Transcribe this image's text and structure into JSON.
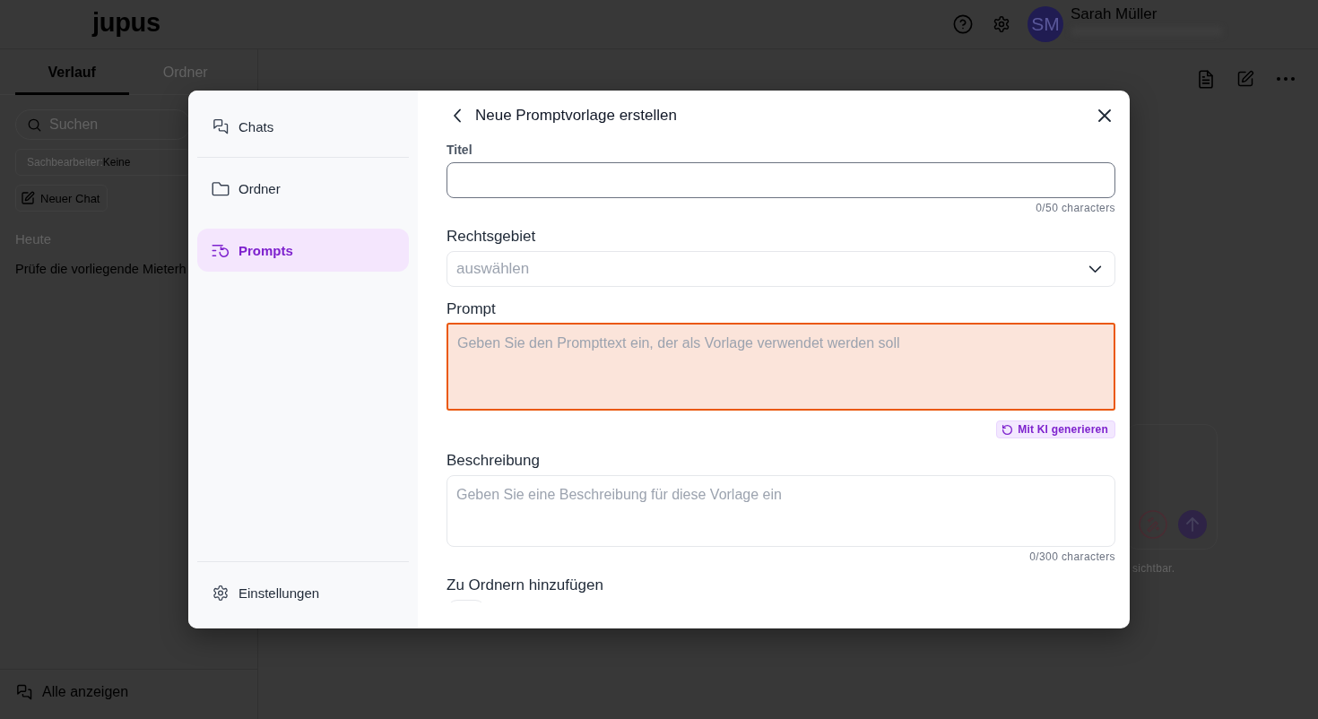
{
  "header": {
    "logo": "jupus",
    "user": {
      "initials": "SM",
      "name": "Sarah Müller"
    }
  },
  "sidebar": {
    "tabs": [
      {
        "label": "Verlauf",
        "selected": true
      },
      {
        "label": "Ordner",
        "selected": false
      }
    ],
    "search": {
      "placeholder": "Suchen"
    },
    "filter": {
      "label": "Sachbearbeiter:",
      "value": "Keine"
    },
    "new_chat": "Neuer Chat",
    "history": [
      {
        "heading": "Heute",
        "items": [
          {
            "title": "Prüfe die vorliegende Mieterh"
          }
        ]
      }
    ],
    "footer_link": "Alle anzeigen"
  },
  "chat": {
    "notice": "sichtbar."
  },
  "modal": {
    "nav": [
      {
        "label": "Chats",
        "selected": false
      },
      {
        "label": "Ordner",
        "selected": false
      },
      {
        "label": "Prompts",
        "selected": true
      }
    ],
    "settings": "Einstellungen",
    "title": "Neue Promptvorlage erstellen",
    "fields": [
      {
        "kind": "input",
        "label": "Titel",
        "focused": true,
        "invalid": false,
        "counter": "0/50 characters"
      },
      {
        "kind": "select",
        "label": "Rechtsgebiet",
        "placeholder": "auswählen",
        "focused": false,
        "invalid": false
      },
      {
        "kind": "textarea",
        "label": "Prompt",
        "placeholder": "Geben Sie den Prompttext ein, der als Vorlage verwendet werden soll",
        "focused": false,
        "invalid": true,
        "action": "Mit KI generieren"
      },
      {
        "kind": "textarea",
        "label": "Beschreibung",
        "placeholder": "Geben Sie eine Beschreibung für diese Vorlage ein",
        "focused": false,
        "invalid": false,
        "counter": "0/300 characters"
      },
      {
        "kind": "chips",
        "label": "Zu Ordnern hinzufügen"
      }
    ]
  }
}
